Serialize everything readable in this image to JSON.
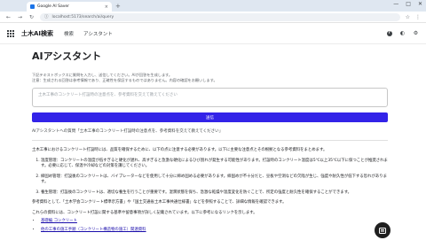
{
  "browser": {
    "tab_title": "Google AI Saver",
    "url": "localhost:5173/search/ai/query",
    "new_tab": "+",
    "tab_close": "×",
    "win_min": "—",
    "win_max": "□",
    "win_close": "✕",
    "back": "←",
    "forward": "→",
    "reload": "↻",
    "star": "☆",
    "menu": "⋮"
  },
  "header": {
    "brand": "土木AI検索",
    "nav": [
      "検索",
      "アシスタント"
    ],
    "help_icon": "?",
    "theme_icon": "◐",
    "settings_icon": "⚙"
  },
  "main": {
    "title": "AIアシスタント",
    "desc_lines": [
      "下記テキストボックスに質問を入力し、送信してください。AIが回答を生成します。",
      "注意：生成される回答は参考情報であり、正確性を保証するものではありません。内容の確認をお願いします。"
    ],
    "input_placeholder": "土木工事のコンクリート打設時の注意点を、参考資料を交えて教えてください",
    "submit_label": "送信",
    "status": "AIアシスタントへの質問「土木工事のコンクリート打設時の注意点を、参考資料を交えて教えてください」"
  },
  "answer": {
    "intro": "土木工事におけるコンクリート打設時には、品質を確保するために、以下の点に注意する必要があります。以下に主要な注意点とその根拠となる参考資料をまとめます。",
    "items": [
      "温度管理：コンクリートの温度が低すぎると硬化が遅れ、高すぎると急激な硬化によるひび割れが発生する可能性があります。打設時のコンクリート温度は5℃以上35℃以下に保つことが推奨されます。必要に応じて、保温や冷却などの対策を講じてください。",
      "締固め管理：打設後のコンクリートは、バイブレーターなどを使用して十分に締め固める必要があります。締固めが不十分だと、豆板や空洞などの欠陥が生じ、強度や耐久性が低下する恐れがあります。",
      "養生管理：打設後のコンクリートは、適切な養生を行うことが重要です。湿潤状態を保ち、急激な乾燥や温度変化を防ぐことで、所定の強度と耐久性を確保することができます。"
    ],
    "refs_intro": "参考資料として、「土木学会コンクリート標準示方書」や「国土交通省土木工事共通仕様書」などを参照することで、詳細な情報を確認できます。",
    "refs_note": "これらの資料には、コンクリート打設に関する基準や留意事項が詳しく記載されています。以下に参考になるリンクを示します。",
    "links": [
      "基礎編 コンクリート",
      "他の工事の施工手順（コンクリート構造物の施工）関連資料"
    ]
  },
  "fab": {
    "icon": "chat-icon"
  }
}
